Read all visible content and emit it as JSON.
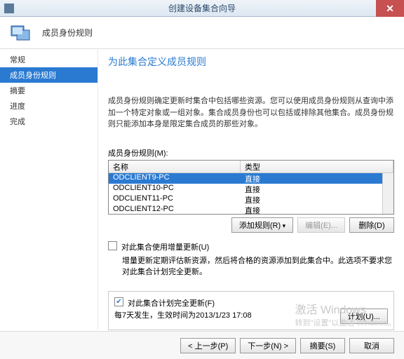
{
  "titlebar": {
    "title": "创建设备集合向导"
  },
  "header": {
    "text": "成员身份规则"
  },
  "sidebar": {
    "items": [
      {
        "label": "常规"
      },
      {
        "label": "成员身份规则"
      },
      {
        "label": "摘要"
      },
      {
        "label": "进度"
      },
      {
        "label": "完成"
      }
    ]
  },
  "content": {
    "title": "为此集合定义成员规则",
    "desc": "成员身份规则确定更新时集合中包括哪些资源。您可以使用成员身份规则从查询中添加一个特定对象或一组对象。集合成员身份也可以包括或排除其他集合。成员身份规则只能添加本身是限定集合成员的那些对象。",
    "list_label": "成员身份规则(M):",
    "grid": {
      "cols": [
        "名称",
        "类型"
      ],
      "rows": [
        {
          "name": "ODCLIENT9-PC",
          "type": "直接",
          "sel": true
        },
        {
          "name": "ODCLIENT10-PC",
          "type": "直接",
          "sel": false
        },
        {
          "name": "ODCLIENT11-PC",
          "type": "直接",
          "sel": false
        },
        {
          "name": "ODCLIENT12-PC",
          "type": "直接",
          "sel": false
        }
      ]
    },
    "btns": {
      "add": "添加规则(R)",
      "edit": "编辑(E)...",
      "del": "删除(D)"
    },
    "inc_chk": "对此集合使用增量更新(U)",
    "inc_desc": "增量更新定期评估新资源，然后将合格的资源添加到此集合中。此选项不要求您对此集合计划完全更新。",
    "full_chk": "对此集合计划完全更新(F)",
    "sched_text": "每7天发生，生效时间为2013/1/23 17:08",
    "sched_btn": "计划(U)..."
  },
  "footer": {
    "prev": "< 上一步(P)",
    "next": "下一步(N) >",
    "summary": "摘要(S)",
    "cancel": "取消"
  },
  "watermark": {
    "line1": "激活 Windows",
    "line2": "转到\"设置\"以激活 Windows。"
  }
}
